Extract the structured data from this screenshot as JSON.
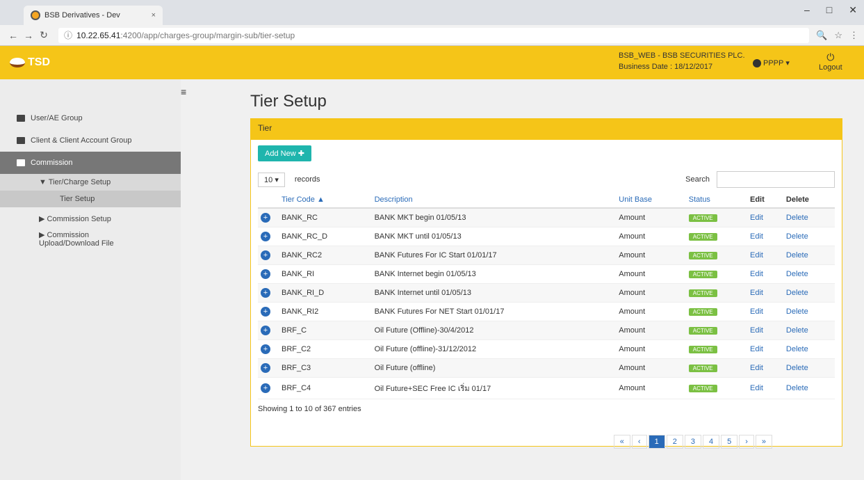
{
  "browser": {
    "tab_title": "BSB Derivatives - Dev",
    "close": "×",
    "url_host": "10.22.65.41",
    "url_path": ":4200/app/charges-group/margin-sub/tier-setup",
    "controls": [
      "–",
      "□",
      "✕"
    ]
  },
  "header": {
    "logo_text": "TSD",
    "company": "BSB_WEB - BSB SECURITIES PLC.",
    "business_date": "Business Date : 18/12/2017",
    "user": "PPPP",
    "logout": "Logout"
  },
  "sidebar": {
    "items": [
      {
        "label": "User/AE Group"
      },
      {
        "label": "Client & Client Account Group"
      },
      {
        "label": "Commission"
      }
    ],
    "sub_active": "Tier/Charge Setup",
    "sub_leaf": "Tier Setup",
    "collapsed": [
      "Commission Setup",
      "Commission Upload/Download File"
    ]
  },
  "main": {
    "title": "Tier Setup",
    "panel_title": "Tier",
    "add_label": "Add New",
    "page_size": "10",
    "records_label": "records",
    "search_label": "Search",
    "columns": [
      "Tier Code",
      "Description",
      "Unit Base",
      "Status",
      "Edit",
      "Delete"
    ],
    "rows": [
      {
        "code": "BANK_RC",
        "desc": "BANK MKT begin 01/05/13",
        "unit": "Amount"
      },
      {
        "code": "BANK_RC_D",
        "desc": "BANK MKT until 01/05/13",
        "unit": "Amount"
      },
      {
        "code": "BANK_RC2",
        "desc": "BANK Futures For IC Start 01/01/17",
        "unit": "Amount"
      },
      {
        "code": "BANK_RI",
        "desc": "BANK Internet begin 01/05/13",
        "unit": "Amount"
      },
      {
        "code": "BANK_RI_D",
        "desc": "BANK Internet until 01/05/13",
        "unit": "Amount"
      },
      {
        "code": "BANK_RI2",
        "desc": "BANK Futures For NET Start 01/01/17",
        "unit": "Amount"
      },
      {
        "code": "BRF_C",
        "desc": "Oil Future (Offline)-30/4/2012",
        "unit": "Amount"
      },
      {
        "code": "BRF_C2",
        "desc": "Oil Future (offline)-31/12/2012",
        "unit": "Amount"
      },
      {
        "code": "BRF_C3",
        "desc": "Oil Future (offline)",
        "unit": "Amount"
      },
      {
        "code": "BRF_C4",
        "desc": "Oil Future+SEC Free IC เริ่ม 01/17",
        "unit": "Amount"
      }
    ],
    "status_label": "ACTIVE",
    "edit_label": "Edit",
    "delete_label": "Delete",
    "footer": "Showing 1 to 10 of 367 entries",
    "pages": [
      "«",
      "‹",
      "1",
      "2",
      "3",
      "4",
      "5",
      "›",
      "»"
    ]
  },
  "colors": {
    "accent": "#f5c518",
    "link": "#2a6bb8",
    "button": "#1fb5ad",
    "status": "#7bc043"
  }
}
